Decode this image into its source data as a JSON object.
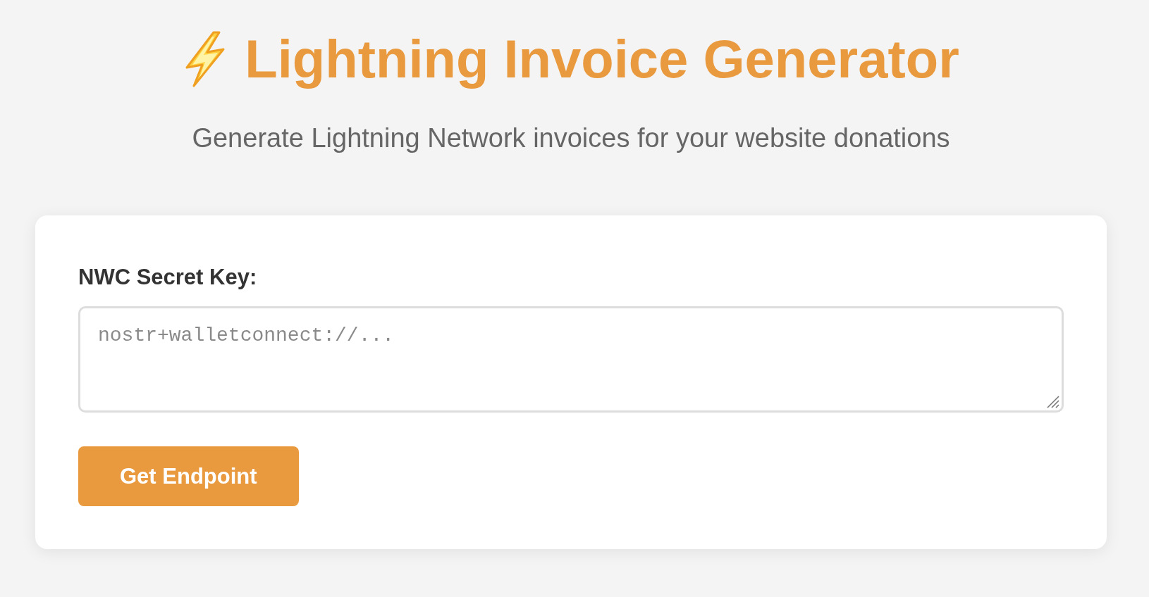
{
  "header": {
    "title": "Lightning Invoice Generator",
    "subtitle": "Generate Lightning Network invoices for your website donations"
  },
  "form": {
    "label": "NWC Secret Key:",
    "field": {
      "placeholder": "nostr+walletconnect://..."
    },
    "button": {
      "label": "Get Endpoint"
    }
  }
}
